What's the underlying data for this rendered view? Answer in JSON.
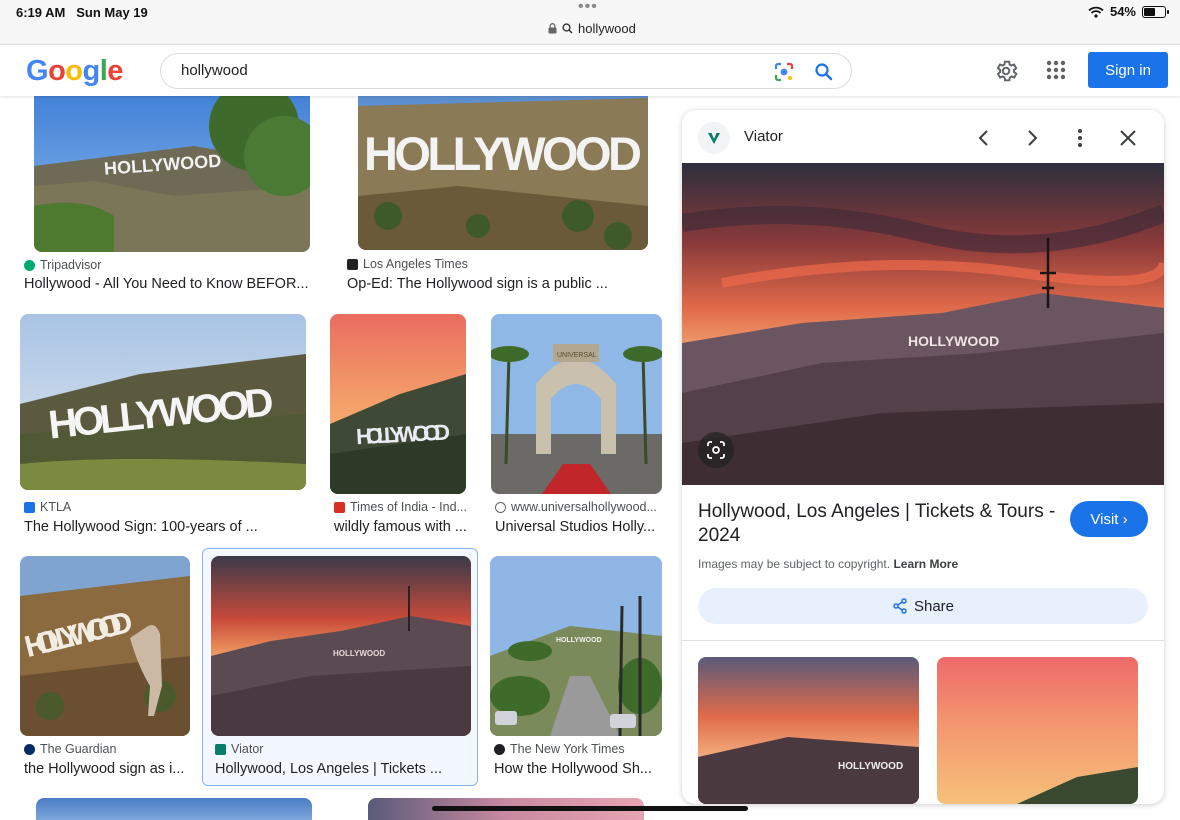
{
  "status_bar": {
    "time": "6:19 AM",
    "date": "Sun May 19",
    "url": "hollywood",
    "battery": "54%"
  },
  "logo": {
    "letters": [
      "G",
      "o",
      "o",
      "g",
      "l",
      "e"
    ],
    "colors": [
      "#4285f4",
      "#ea4335",
      "#fbbc05",
      "#4285f4",
      "#34a853",
      "#ea4335"
    ]
  },
  "search": {
    "query": "hollywood"
  },
  "header": {
    "sign_in": "Sign in"
  },
  "results": [
    {
      "source": "Tripadvisor",
      "title": "Hollywood - All You Need to Know BEFOR...",
      "favicon_color": "#00aa6c"
    },
    {
      "source": "Los Angeles Times",
      "title": "Op-Ed: The Hollywood sign is a public ...",
      "favicon_color": "#202124"
    },
    {
      "source": "KTLA",
      "title": "The Hollywood Sign: 100-years of ...",
      "favicon_color": "#1a73e8"
    },
    {
      "source": "Times of India - Ind...",
      "title": "wildly famous with ...",
      "favicon_color": "#d93025"
    },
    {
      "source": "www.universalhollywood...",
      "title": "Universal Studios Holly...",
      "favicon_color": "#5f6368"
    },
    {
      "source": "The Guardian",
      "title": "the Hollywood sign as i...",
      "favicon_color": "#052962"
    },
    {
      "source": "Viator",
      "title": "Hollywood, Los Angeles | Tickets ...",
      "favicon_color": "#0a7c6a"
    },
    {
      "source": "The New York Times",
      "title": "How the Hollywood Sh...",
      "favicon_color": "#202124"
    }
  ],
  "panel": {
    "source": "Viator",
    "title": "Hollywood, Los Angeles | Tickets & Tours - 2024",
    "visit": "Visit",
    "copyright": "Images may be subject to copyright.",
    "learn_more": "Learn More",
    "share": "Share"
  },
  "sign_texts": {
    "tripadvisor": "HOLLYWOOD",
    "latimes": "HOLLYWOOD",
    "ktla": "HOLLYWOOD",
    "toi": "HOLLYWOOD",
    "universal": "UNIVERSAL",
    "guardian": "HOLLYWOOD",
    "viator": "HOLLYWOOD",
    "nyt": "HOLLYWOOD",
    "panel": "HOLLYWOOD",
    "related": "HOLLYWOOD"
  }
}
